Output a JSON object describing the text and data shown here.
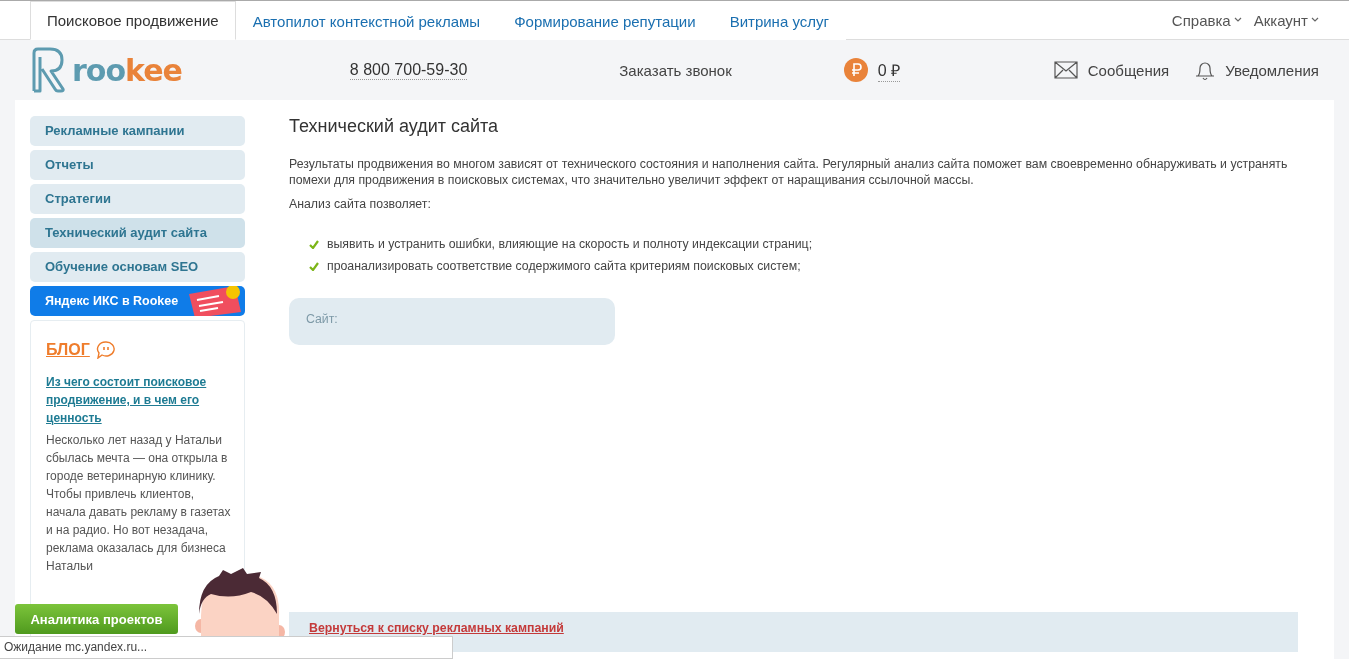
{
  "top_tabs": [
    {
      "label": "Поисковое продвижение",
      "selected": true
    },
    {
      "label": "Автопилот контекстной рекламы",
      "selected": false
    },
    {
      "label": "Формирование репутации",
      "selected": false
    },
    {
      "label": "Витрина услуг",
      "selected": false
    }
  ],
  "top_menus": [
    "Справка",
    "Аккаунт"
  ],
  "header": {
    "logo": [
      "roo",
      "kee"
    ],
    "phone": "8 800 700-59-30",
    "callback": "Заказать звонок",
    "balance": "0 ₽",
    "messages": "Сообщения",
    "notifications": "Уведомления"
  },
  "sidebar": {
    "items": [
      {
        "kind": "menu",
        "label": "Рекламные кампании",
        "selected": false
      },
      {
        "kind": "menu",
        "label": "Отчеты",
        "selected": false
      },
      {
        "kind": "menu",
        "label": "Стратегии",
        "selected": false
      },
      {
        "kind": "menu",
        "label": "Технический аудит сайта",
        "selected": true
      },
      {
        "kind": "menu",
        "label": "Обучение основам SEO",
        "selected": false
      },
      {
        "kind": "promo",
        "label": "Яндекс ИКС в Rookee",
        "selected": false
      }
    ],
    "blog": {
      "heading": "БЛОГ",
      "title": "Из чего состоит поисковое продвижение, и в чем его ценность",
      "text": "Несколько лет назад у Натальи сбылась мечта — она открыла в городе ветеринарную клинику. Чтобы привлечь клиентов, начала давать рекламу в газетах и на радио. Но вот незадача, реклама оказалась для бизнеса Натальи"
    }
  },
  "content": {
    "title": "Технический аудит сайта",
    "intro": "Результаты продвижения во многом зависят от технического состояния и наполнения сайта. Регулярный анализ сайта поможет вам своевременно обнаруживать и устранять помехи для продвижения в поисковых системах, что значительно увеличит эффект от наращивания ссылочной массы.",
    "lead": "Анализ сайта позволяет:",
    "bullets": [
      "выявить и устранить ошибки, влияющие на скорость и полноту индексации страниц;",
      "проанализировать соответствие содержимого сайта критериям поисковых систем;"
    ],
    "site_label": "Сайт:",
    "back_link": "Вернуться к списку рекламных кампаний"
  },
  "analytics_button": "Аналитика проектов",
  "status_bar": "Ожидание mc.yandex.ru..."
}
